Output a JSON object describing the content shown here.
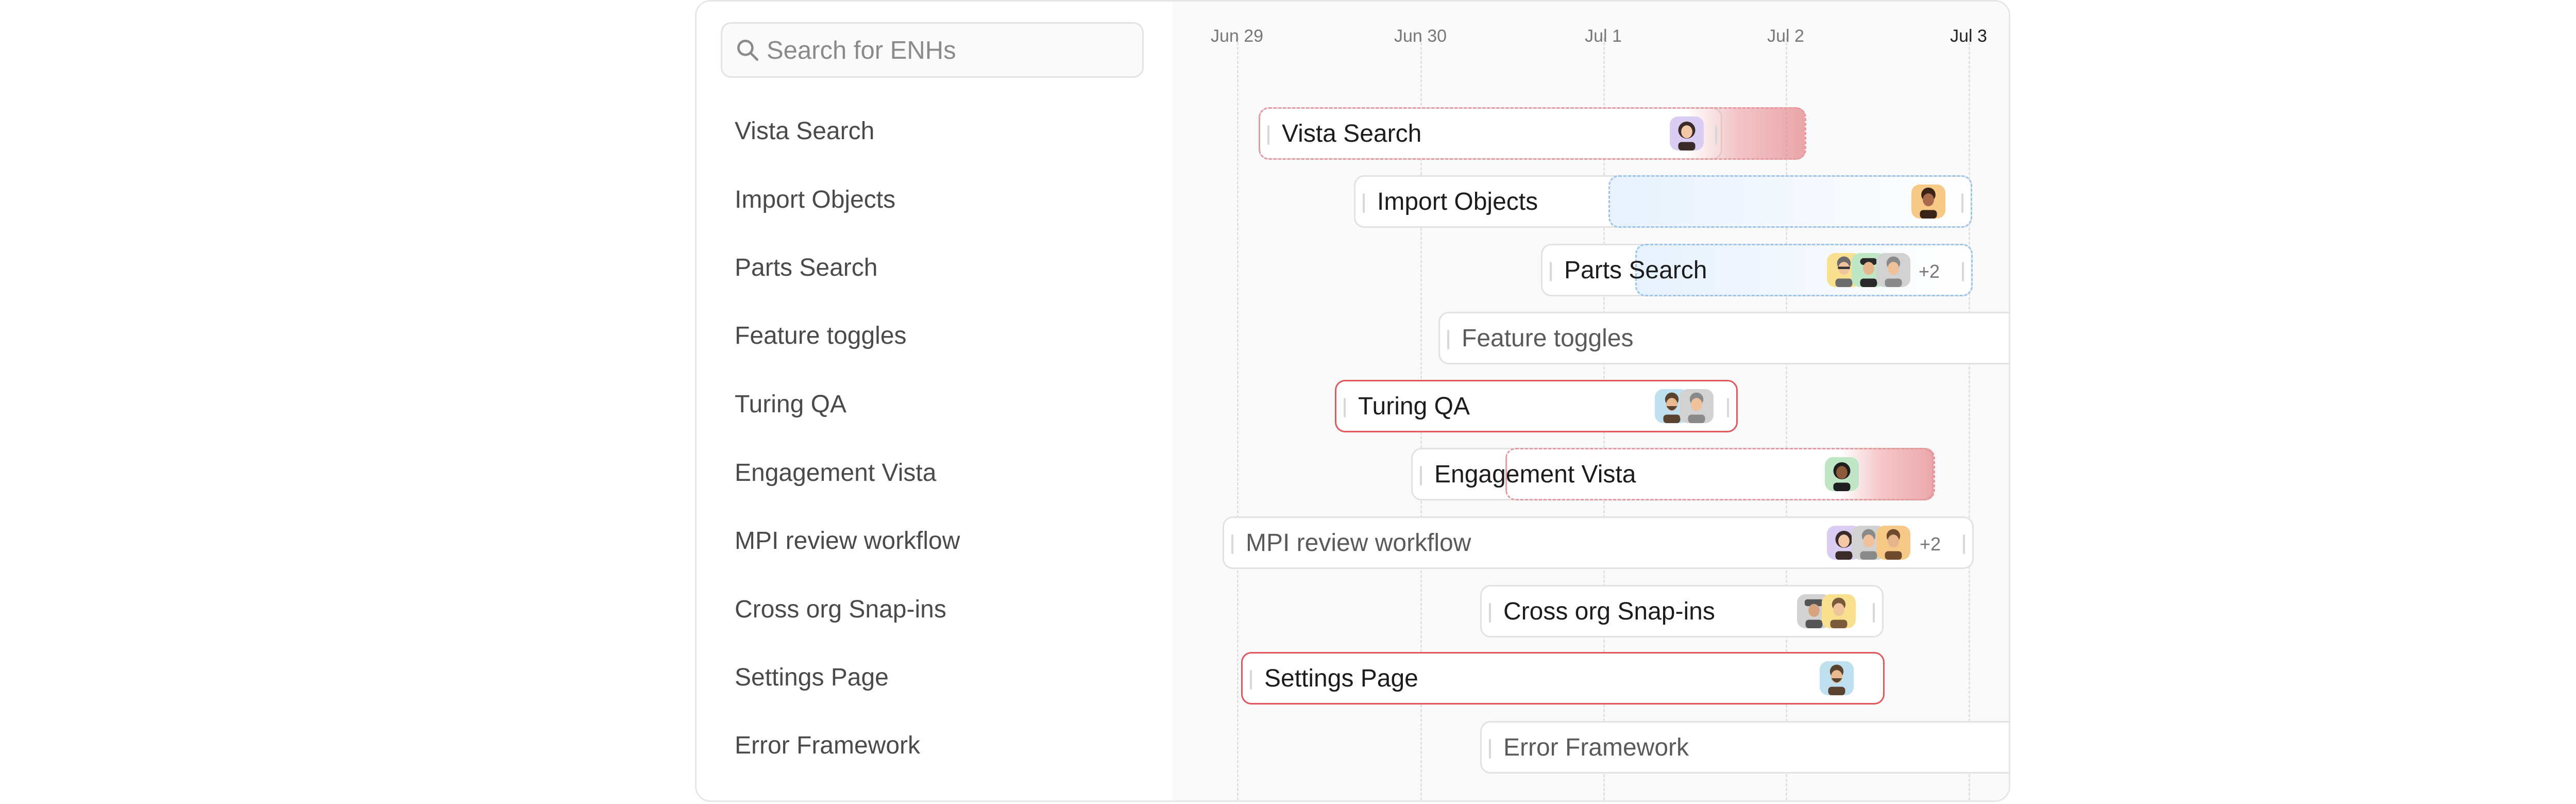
{
  "search": {
    "placeholder": "Search for ENHs"
  },
  "items": [
    "Vista Search",
    "Import Objects",
    "Parts Search",
    "Feature toggles",
    "Turing QA",
    "Engagement Vista",
    "MPI review workflow",
    "Cross org Snap-ins",
    "Settings Page",
    "Error Framework"
  ],
  "timeline": {
    "dates": [
      "Jun 29",
      "Jun 30",
      "Jul 1",
      "Jul 2",
      "Jul 3"
    ],
    "today": "Jul 3"
  },
  "bars": [
    {
      "label": "Vista Search",
      "status": "overdue",
      "avatars": [
        "avatar-woman"
      ]
    },
    {
      "label": "Import Objects",
      "status": "in-progress",
      "avatars": [
        "avatar-man"
      ]
    },
    {
      "label": "Parts Search",
      "status": "in-progress",
      "avatars": [
        "avatar-man-glasses",
        "avatar-man-cap",
        "avatar-man-grey"
      ],
      "more": "+2"
    },
    {
      "label": "Feature toggles",
      "status": "muted",
      "avatars": []
    },
    {
      "label": "Turing QA",
      "status": "overdue",
      "avatars": [
        "avatar-man-beard",
        "avatar-man-grey"
      ]
    },
    {
      "label": "Engagement Vista",
      "status": "overdue",
      "avatars": [
        "avatar-woman-dark"
      ]
    },
    {
      "label": "MPI review workflow",
      "status": "muted",
      "avatars": [
        "avatar-woman",
        "avatar-man-grey",
        "avatar-man-orange"
      ],
      "more": "+2"
    },
    {
      "label": "Cross org Snap-ins",
      "status": "normal",
      "avatars": [
        "avatar-man-hat",
        "avatar-man-yellow"
      ]
    },
    {
      "label": "Settings Page",
      "status": "overdue",
      "avatars": [
        "avatar-man-beard"
      ]
    },
    {
      "label": "Error Framework",
      "status": "muted",
      "avatars": []
    }
  ],
  "colors": {
    "overdue": "#e0585c",
    "in_progress": "#9fc4ea",
    "avatar_purple": "#d9cdf3",
    "avatar_orange": "#f6c987",
    "avatar_yellow": "#f8e08e",
    "avatar_green": "#bfe7c5",
    "avatar_blue": "#bfe0ef",
    "avatar_grey": "#d2d2d2"
  }
}
